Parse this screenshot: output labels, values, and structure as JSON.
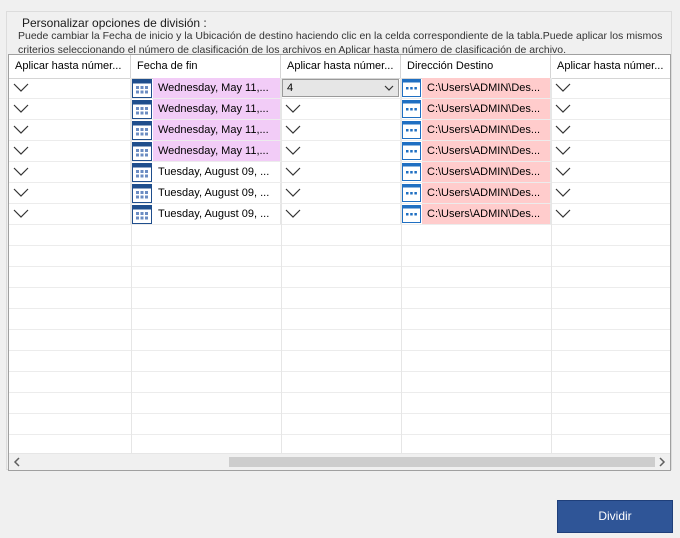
{
  "group": {
    "title": "Personalizar opciones de división :",
    "description": "Puede cambiar la Fecha de inicio y la Ubicación de destino haciendo clic en la celda correspondiente de la tabla.Puede aplicar los mismos criterios seleccionando el número de clasificación de los archivos en Aplicar hasta número de clasificación de archivo."
  },
  "table": {
    "headers": [
      "Aplicar hasta númer...",
      "Fecha de fin",
      "Aplicar hasta númer...",
      "Dirección Destino",
      "Aplicar hasta númer..."
    ],
    "rows": [
      {
        "end_date": "Wednesday, May 11,...",
        "apply_value": "4",
        "destination": "C:\\Users\\ADMIN\\Des...",
        "highlight": "#f2ccf7"
      },
      {
        "end_date": "Wednesday, May 11,...",
        "apply_value": "",
        "destination": "C:\\Users\\ADMIN\\Des...",
        "highlight": "#f2ccf7"
      },
      {
        "end_date": "Wednesday, May 11,...",
        "apply_value": "",
        "destination": "C:\\Users\\ADMIN\\Des...",
        "highlight": "#f2ccf7"
      },
      {
        "end_date": "Wednesday, May 11,...",
        "apply_value": "",
        "destination": "C:\\Users\\ADMIN\\Des...",
        "highlight": "#f2ccf7"
      },
      {
        "end_date": "Tuesday, August 09, ...",
        "apply_value": "",
        "destination": "C:\\Users\\ADMIN\\Des...",
        "highlight": "#ffffff"
      },
      {
        "end_date": "Tuesday, August 09, ...",
        "apply_value": "",
        "destination": "C:\\Users\\ADMIN\\Des...",
        "highlight": "#ffffff"
      },
      {
        "end_date": "Tuesday, August 09, ...",
        "apply_value": "",
        "destination": "C:\\Users\\ADMIN\\Des...",
        "highlight": "#ffffff"
      }
    ]
  },
  "icons": {
    "dropdown": "chevron-down-icon",
    "calendar": "calendar-icon",
    "folder_browse": "browse-folder-icon",
    "scroll_left": "arrow-left-icon",
    "scroll_right": "arrow-right-icon"
  },
  "colors": {
    "accent": "#2f5597",
    "date_highlight": "#f2ccf7",
    "destination_bg": "#ffcccc"
  },
  "actions": {
    "split_label": "Dividir"
  }
}
